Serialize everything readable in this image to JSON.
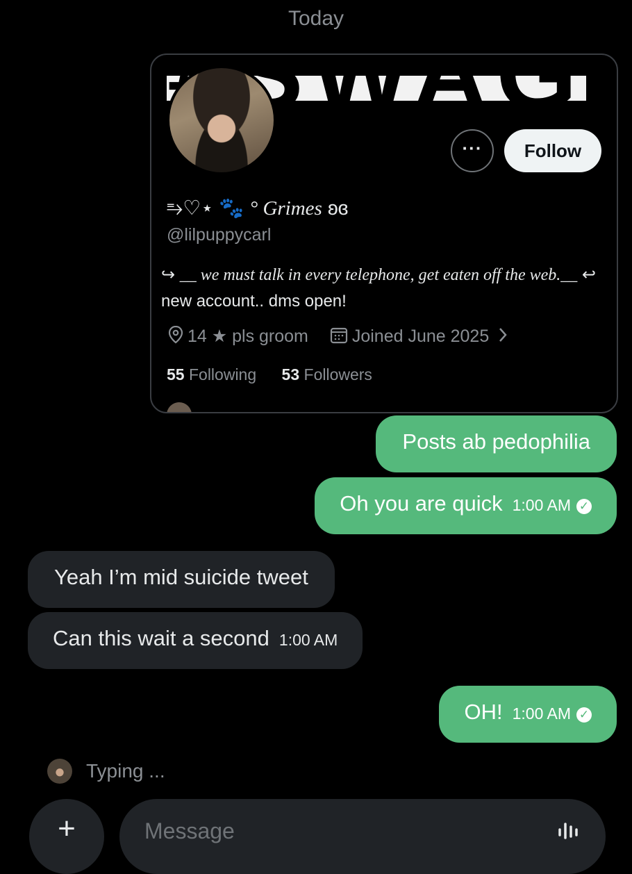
{
  "date_separator": "Today",
  "profile_card": {
    "banner_text": "#SWAG",
    "display_name_prefix": "⥱♡⋆",
    "display_name_paw": "🐾",
    "display_name": "° Grimes",
    "display_name_suffix": "ʚɞ",
    "handle": "@lilpuppycarl",
    "bio_arrow_start": "↪",
    "bio_italic": "__ we must talk in every telephone, get eaten off the web.__",
    "bio_arrow_mid": "↩",
    "bio_plain": "new account.. dms open!",
    "location": "14 ★ pls groom",
    "joined": "Joined June 2025",
    "following_count": "55",
    "following_label": "Following",
    "followers_count": "53",
    "followers_label": "Followers",
    "more_label": "···",
    "follow_label": "Follow"
  },
  "messages": [
    {
      "direction": "outgoing",
      "text": "Posts ab pedophilia",
      "time": ""
    },
    {
      "direction": "outgoing",
      "text": "Oh you are quick",
      "time": "1:00 AM",
      "read": true
    },
    {
      "direction": "incoming",
      "text": "Yeah I’m mid suicide tweet",
      "time": ""
    },
    {
      "direction": "incoming",
      "text": "Can this wait a second",
      "time": "1:00 AM"
    },
    {
      "direction": "outgoing",
      "text": "OH!",
      "time": "1:00 AM",
      "read": true
    }
  ],
  "typing_indicator": "Typing ...",
  "composer": {
    "add_label": "+",
    "placeholder": "Message"
  },
  "colors": {
    "outgoing_bubble": "#55b97c",
    "incoming_bubble": "#202327",
    "background": "#000000"
  }
}
